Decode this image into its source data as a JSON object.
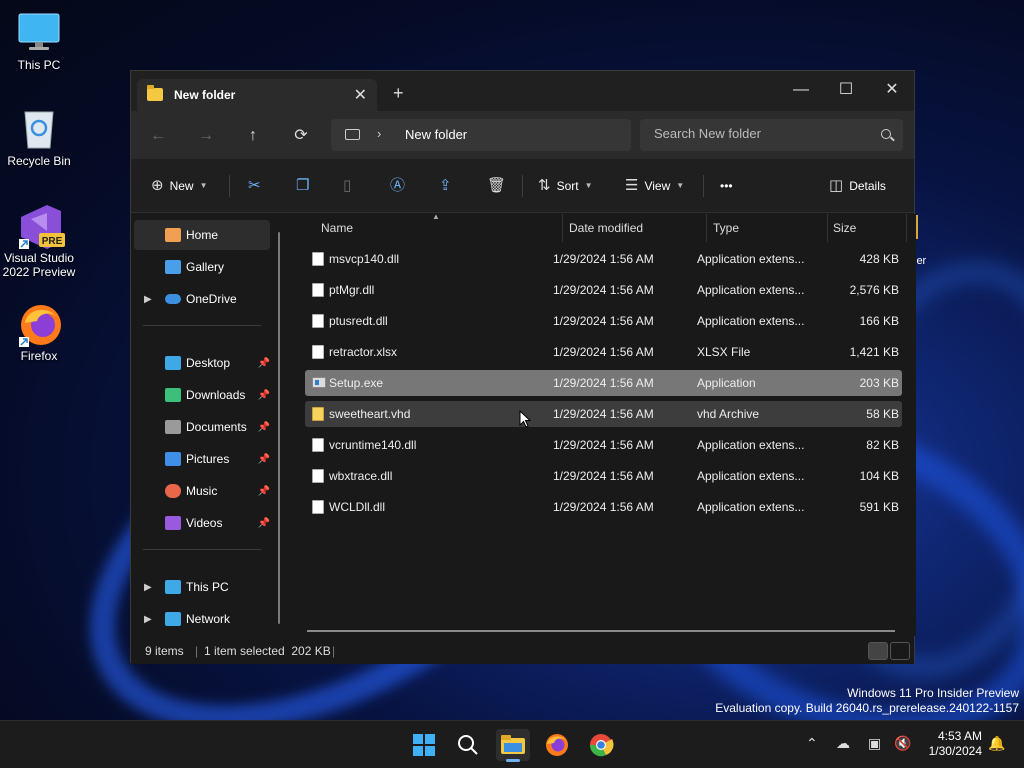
{
  "desktop": {
    "icons": [
      {
        "label": "This PC"
      },
      {
        "label": "Recycle Bin"
      },
      {
        "label": "Visual Studio 2022 Preview",
        "badge": "PRE"
      },
      {
        "label": "Firefox"
      }
    ],
    "partial_label": "ler"
  },
  "window": {
    "tab_title": "New folder",
    "new_tab": "+",
    "controls": {
      "minimize": "—",
      "maximize": "☐",
      "close": "✕"
    }
  },
  "nav": {
    "back": "←",
    "forward": "→",
    "up": "↑",
    "refresh": "⟳",
    "breadcrumb": [
      "New folder"
    ],
    "chevron": "›",
    "search_placeholder": "Search New folder"
  },
  "commandbar": {
    "new_label": "New",
    "sort_label": "Sort",
    "view_label": "View",
    "more_label": "•••",
    "details_label": "Details"
  },
  "sidebar": {
    "items": [
      {
        "label": "Home",
        "selected": true,
        "icon": "home-icon",
        "color": "#f0a050"
      },
      {
        "label": "Gallery",
        "icon": "gallery-icon",
        "color": "#4aa0e8"
      },
      {
        "label": "OneDrive",
        "icon": "onedrive-icon",
        "color": "#3d8fe0",
        "expandable": true
      },
      {
        "label": "Desktop",
        "icon": "desktop-icon",
        "color": "#3fa9e8",
        "pinned": true
      },
      {
        "label": "Downloads",
        "icon": "downloads-icon",
        "color": "#3bbf7a",
        "pinned": true
      },
      {
        "label": "Documents",
        "icon": "documents-icon",
        "color": "#9a9a9a",
        "pinned": true
      },
      {
        "label": "Pictures",
        "icon": "pictures-icon",
        "color": "#3f8ee8",
        "pinned": true
      },
      {
        "label": "Music",
        "icon": "music-icon",
        "color": "#e8664a",
        "pinned": true
      },
      {
        "label": "Videos",
        "icon": "videos-icon",
        "color": "#9a5ae0",
        "pinned": true
      },
      {
        "label": "This PC",
        "icon": "this-pc-icon",
        "color": "#3fa9e8",
        "expandable": true
      },
      {
        "label": "Network",
        "icon": "network-icon",
        "color": "#3fa9e8",
        "expandable": true
      }
    ]
  },
  "files": {
    "columns": [
      "Name",
      "Date modified",
      "Type",
      "Size"
    ],
    "rows": [
      {
        "name": "msvcp140.dll",
        "date": "1/29/2024 1:56 AM",
        "type": "Application extens...",
        "size": "428 KB",
        "kind": "dll"
      },
      {
        "name": "ptMgr.dll",
        "date": "1/29/2024 1:56 AM",
        "type": "Application extens...",
        "size": "2,576 KB",
        "kind": "dll"
      },
      {
        "name": "ptusredt.dll",
        "date": "1/29/2024 1:56 AM",
        "type": "Application extens...",
        "size": "166 KB",
        "kind": "dll"
      },
      {
        "name": "retractor.xlsx",
        "date": "1/29/2024 1:56 AM",
        "type": "XLSX File",
        "size": "1,421 KB",
        "kind": "xl"
      },
      {
        "name": "Setup.exe",
        "date": "1/29/2024 1:56 AM",
        "type": "Application",
        "size": "203 KB",
        "kind": "exe",
        "state": "sel"
      },
      {
        "name": "sweetheart.vhd",
        "date": "1/29/2024 1:56 AM",
        "type": "vhd Archive",
        "size": "58 KB",
        "kind": "vhd",
        "state": "hover"
      },
      {
        "name": "vcruntime140.dll",
        "date": "1/29/2024 1:56 AM",
        "type": "Application extens...",
        "size": "82 KB",
        "kind": "dll"
      },
      {
        "name": "wbxtrace.dll",
        "date": "1/29/2024 1:56 AM",
        "type": "Application extens...",
        "size": "104 KB",
        "kind": "dll"
      },
      {
        "name": "WCLDll.dll",
        "date": "1/29/2024 1:56 AM",
        "type": "Application extens...",
        "size": "591 KB",
        "kind": "dll"
      }
    ]
  },
  "status": {
    "items_count": "9 items",
    "selection": "1 item selected  202 KB",
    "sep": "|"
  },
  "watermark": {
    "line1": "Windows 11 Pro Insider Preview",
    "line2": "Evaluation copy. Build 26040.rs_prerelease.240122-1157"
  },
  "taskbar": {
    "time": "4:53 AM",
    "date": "1/30/2024"
  }
}
